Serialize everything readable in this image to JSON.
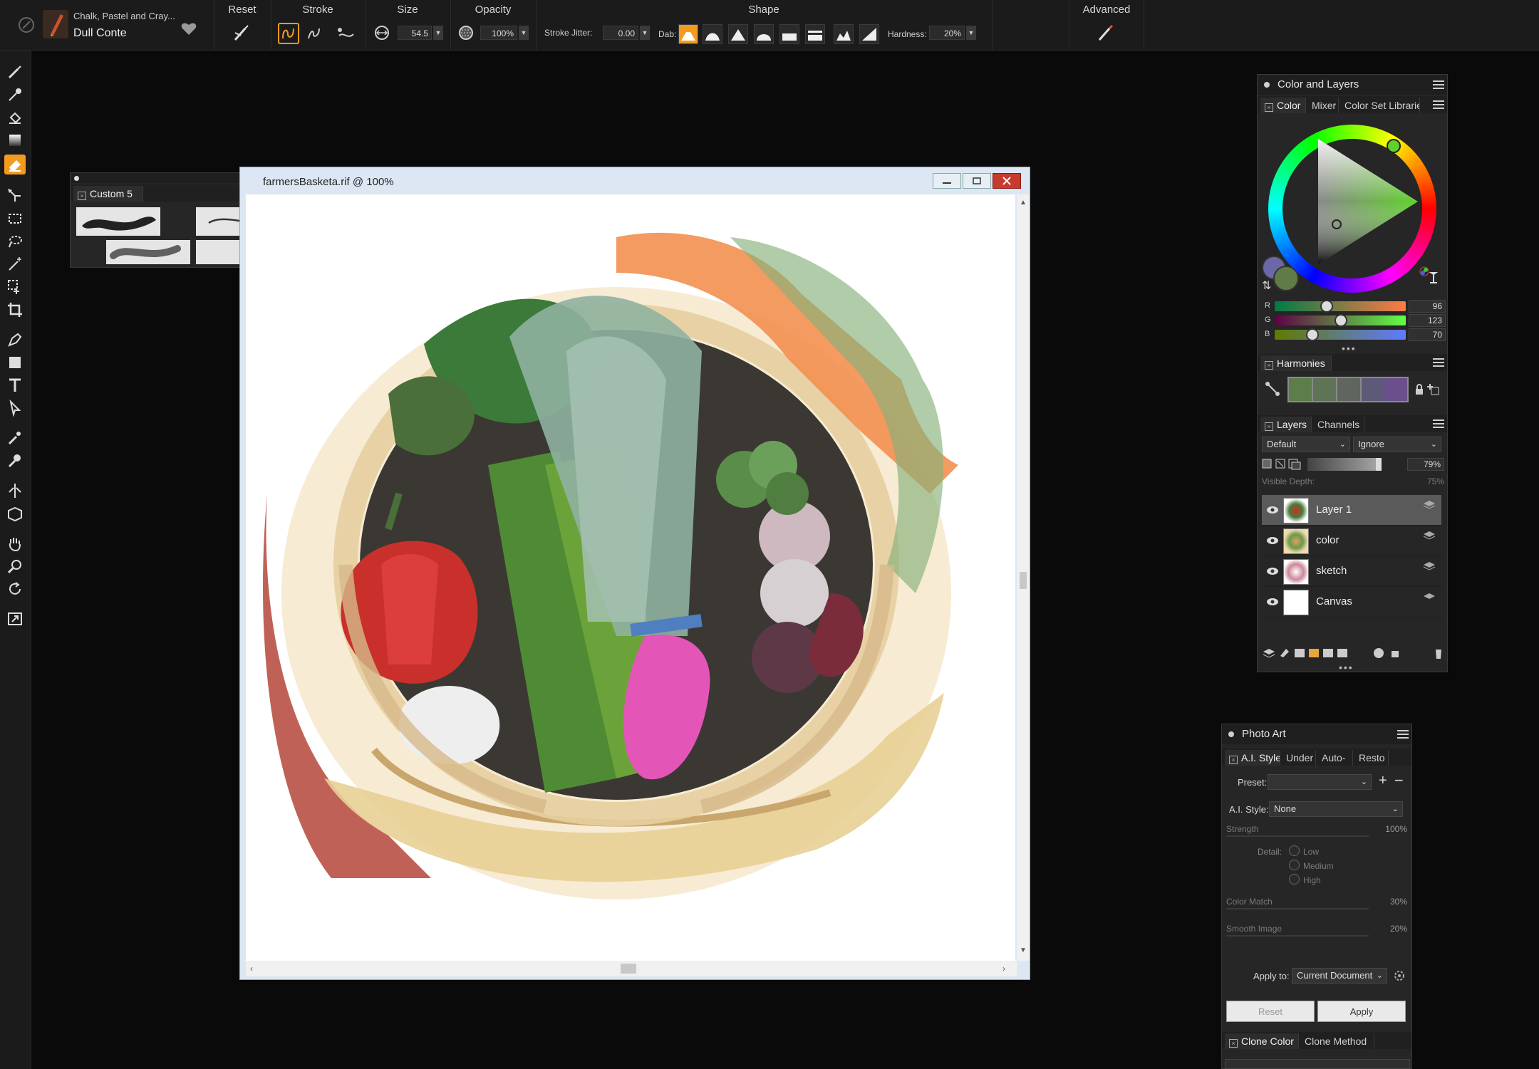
{
  "brush": {
    "category": "Chalk, Pastel and Cray...",
    "variant": "Dull Conte"
  },
  "propbar": {
    "reset": "Reset",
    "stroke": "Stroke",
    "size": "Size",
    "size_value": "54.5",
    "opacity": "Opacity",
    "opacity_value": "100%",
    "shape": "Shape",
    "stroke_jitter_label": "Stroke Jitter:",
    "stroke_jitter_value": "0.00",
    "dab_label": "Dab:",
    "hardness_label": "Hardness:",
    "hardness_value": "20%",
    "advanced": "Advanced"
  },
  "custom_palette": {
    "title": "Custom 5"
  },
  "document": {
    "title": "farmersBasketa.rif @ 100%"
  },
  "color_layers": {
    "title": "Color and Layers",
    "tabs": [
      "Color",
      "Mixer",
      "Color Set Librarie"
    ],
    "rgb": {
      "r_label": "R",
      "g_label": "G",
      "b_label": "B",
      "r": "96",
      "g": "123",
      "b": "70"
    },
    "harmonies_tab": "Harmonies",
    "harmony_colors": [
      "#5d7d4a",
      "#5f7357",
      "#60665e",
      "#5d5a78",
      "#6a4f8c"
    ],
    "layers_tab": "Layers",
    "channels_tab": "Channels",
    "composite_method": "Default",
    "preserve": "Ignore",
    "opacity_value": "79%",
    "visible_depth_label": "Visible Depth:",
    "visible_depth_value": "75%",
    "layers": [
      {
        "name": "Layer 1"
      },
      {
        "name": "color"
      },
      {
        "name": "sketch"
      },
      {
        "name": "Canvas"
      }
    ]
  },
  "photo_art": {
    "title": "Photo Art",
    "tabs": [
      "A.I. Style",
      "Under",
      "Auto-",
      "Resto"
    ],
    "preset_label": "Preset:",
    "ai_style_label": "A.I. Style:",
    "ai_style_value": "None",
    "strength_label": "Strength",
    "strength_value": "100%",
    "detail_label": "Detail:",
    "detail_options": [
      "Low",
      "Medium",
      "High"
    ],
    "color_match_label": "Color Match",
    "color_match_value": "30%",
    "smooth_image_label": "Smooth Image",
    "smooth_image_value": "20%",
    "apply_to_label": "Apply to:",
    "apply_to_value": "Current Document",
    "reset_button": "Reset",
    "apply_button": "Apply",
    "bottom_tabs": [
      "Clone Color",
      "Clone Method"
    ]
  },
  "colors": {
    "accent": "#f39a1f",
    "main_color": "#607b46",
    "secondary_color": "#6c67a8"
  }
}
